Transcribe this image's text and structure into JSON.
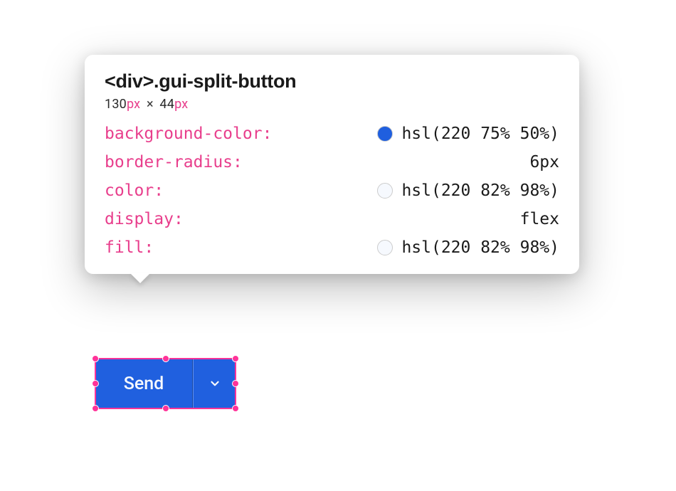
{
  "tooltip": {
    "selector": "<div>.gui-split-button",
    "dimensions": {
      "width_value": "130",
      "width_unit": "px",
      "sep": "×",
      "height_value": "44",
      "height_unit": "px"
    },
    "properties": [
      {
        "key": "background-color",
        "value": "hsl(220 75% 50%)",
        "swatch": "#1f5fdf"
      },
      {
        "key": "border-radius",
        "value": "6px",
        "swatch": null
      },
      {
        "key": "color",
        "value": "hsl(220 82% 98%)",
        "swatch": "#f6f9fe"
      },
      {
        "key": "display",
        "value": "flex",
        "swatch": null
      },
      {
        "key": "fill",
        "value": "hsl(220 82% 98%)",
        "swatch": "#f6f9fe"
      }
    ]
  },
  "button": {
    "label": "Send"
  }
}
